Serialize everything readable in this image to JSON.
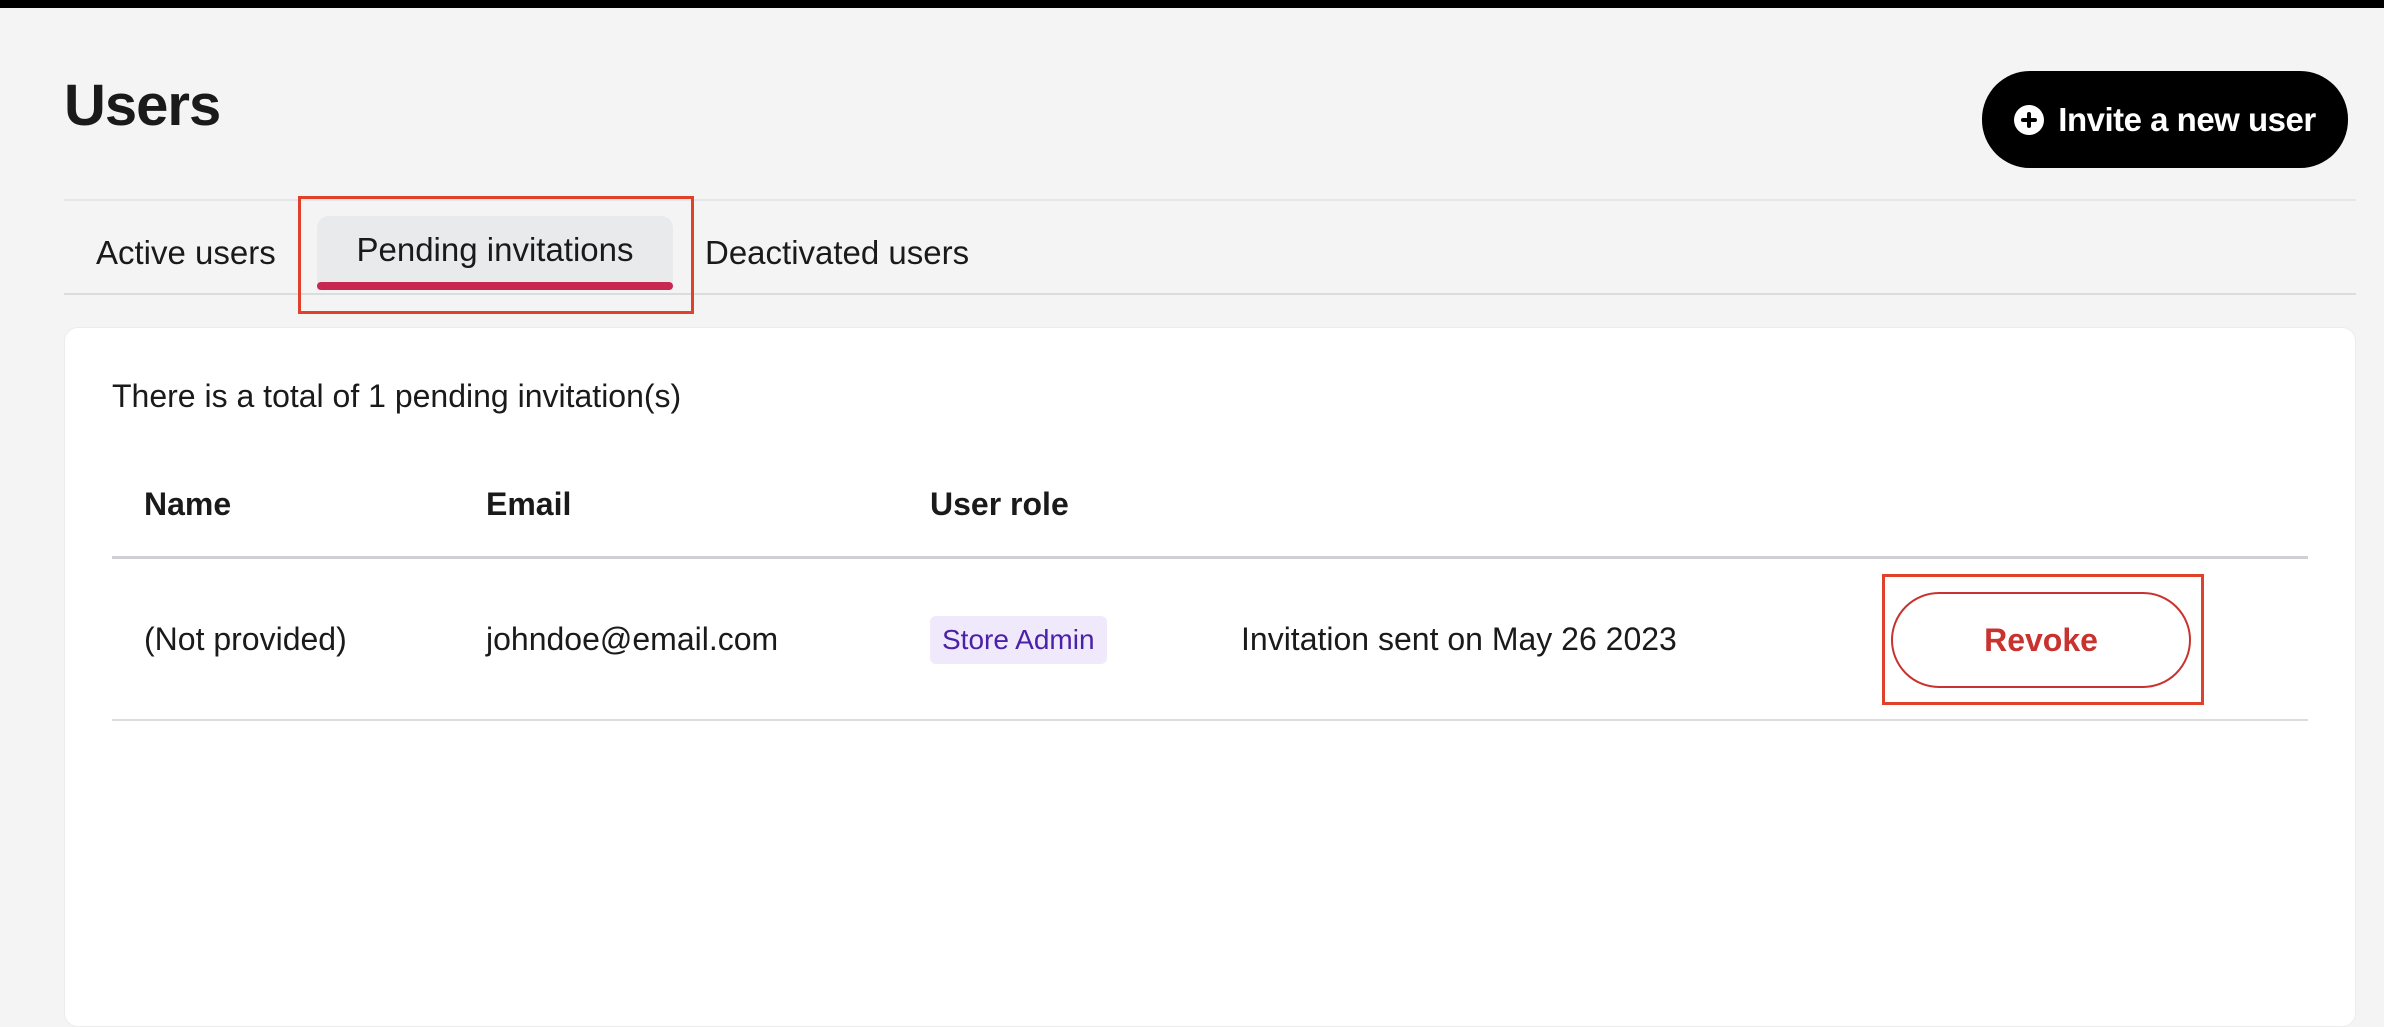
{
  "header": {
    "title": "Users",
    "invite_button_label": "Invite a new user",
    "invite_icon": "plus-circle-icon"
  },
  "tabs": [
    {
      "label": "Active users",
      "active": false
    },
    {
      "label": "Pending invitations",
      "active": true
    },
    {
      "label": "Deactivated users",
      "active": false
    }
  ],
  "panel": {
    "summary": "There is a total of 1 pending invitation(s)",
    "columns": [
      "Name",
      "Email",
      "User role"
    ],
    "rows": [
      {
        "name": "(Not provided)",
        "email": "johndoe@email.com",
        "role": "Store Admin",
        "sent": "Invitation sent on May 26 2023",
        "action_label": "Revoke"
      }
    ]
  },
  "colors": {
    "accent": "#c8274f",
    "revoke": "#c8322f",
    "highlight": "#e0412b",
    "role_badge_bg": "#efe9fb",
    "role_badge_text": "#4b21a8"
  }
}
